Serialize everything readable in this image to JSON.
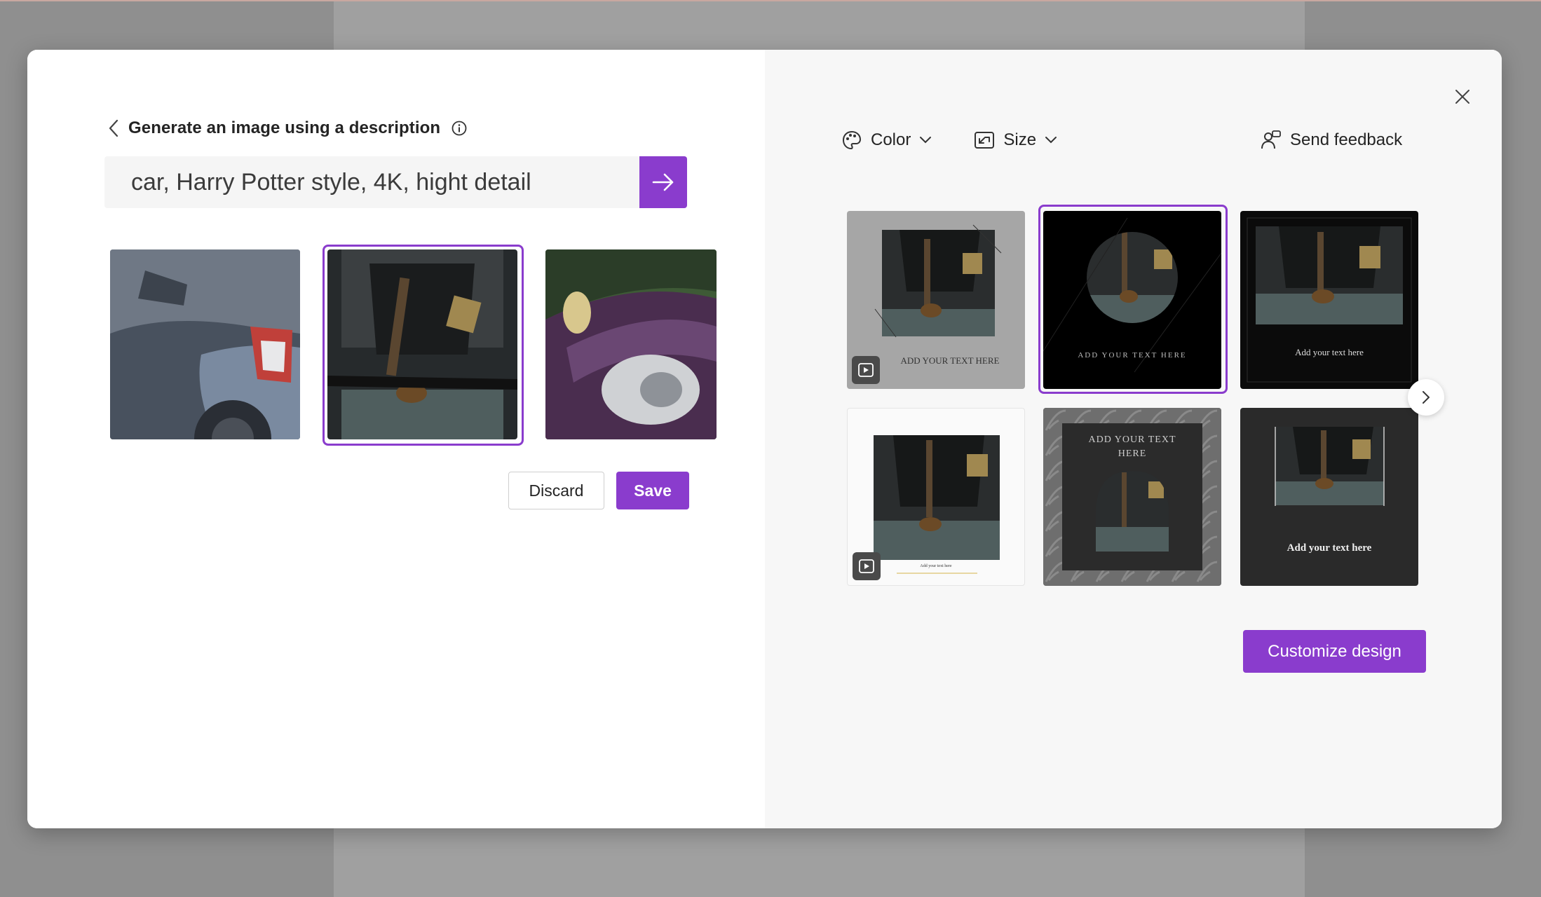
{
  "header": {
    "back_title": "Generate an image using a description"
  },
  "prompt": {
    "value": "car, Harry Potter style, 4K, hight detail"
  },
  "actions": {
    "discard_label": "Discard",
    "save_label": "Save"
  },
  "toolbar": {
    "color_label": "Color",
    "size_label": "Size",
    "feedback_label": "Send feedback"
  },
  "designs": {
    "card1_text": "ADD YOUR TEXT HERE",
    "card2_text": "ADD YOUR TEXT HERE",
    "card3_text": "Add your text here",
    "card4_text": "Add your text here",
    "card5_text": "ADD YOUR TEXT HERE",
    "card6_text": "Add your text here"
  },
  "customize_label": "Customize design",
  "colors": {
    "accent": "#8a3ccd"
  }
}
